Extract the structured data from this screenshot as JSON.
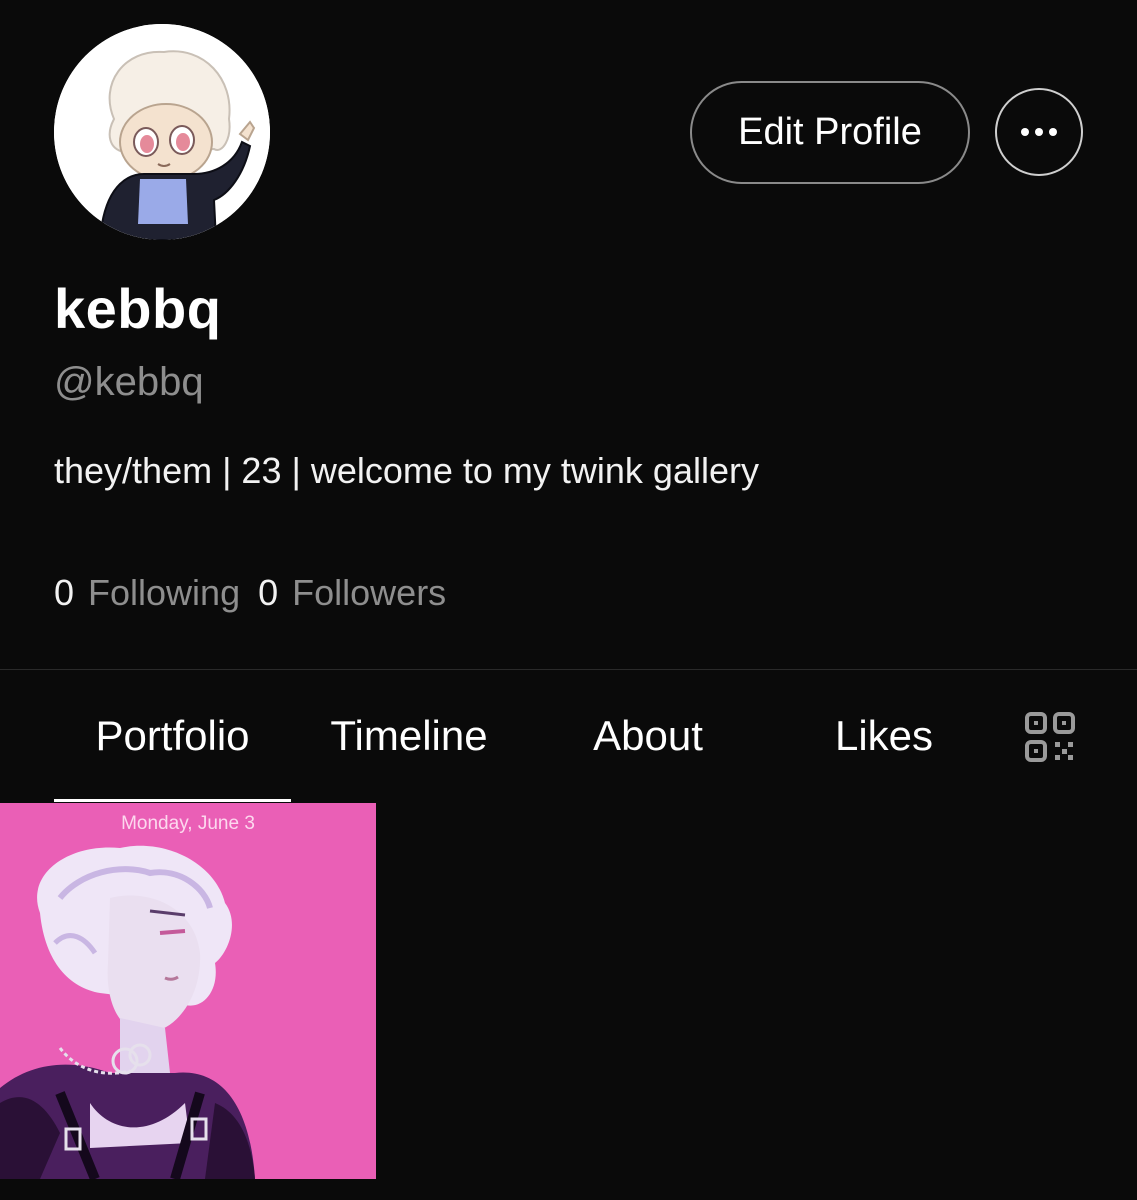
{
  "profile": {
    "display_name": "kebbq",
    "handle": "@kebbq",
    "bio": "they/them | 23 | welcome to my twink gallery",
    "following_count": "0",
    "following_label": "Following",
    "followers_count": "0",
    "followers_label": "Followers"
  },
  "actions": {
    "edit_label": "Edit Profile",
    "more_icon": "more-horizontal-icon"
  },
  "tabs": [
    {
      "label": "Portfolio",
      "active": true
    },
    {
      "label": "Timeline",
      "active": false
    },
    {
      "label": "About",
      "active": false
    },
    {
      "label": "Likes",
      "active": false
    }
  ],
  "tab_icon": "qr-code-icon",
  "portfolio": [
    {
      "caption": "Monday, June 3"
    }
  ],
  "colors": {
    "background": "#0a0a0a",
    "text_primary": "#ffffff",
    "text_secondary": "#8e8e8e",
    "tile_pink": "#ea5fb6"
  }
}
